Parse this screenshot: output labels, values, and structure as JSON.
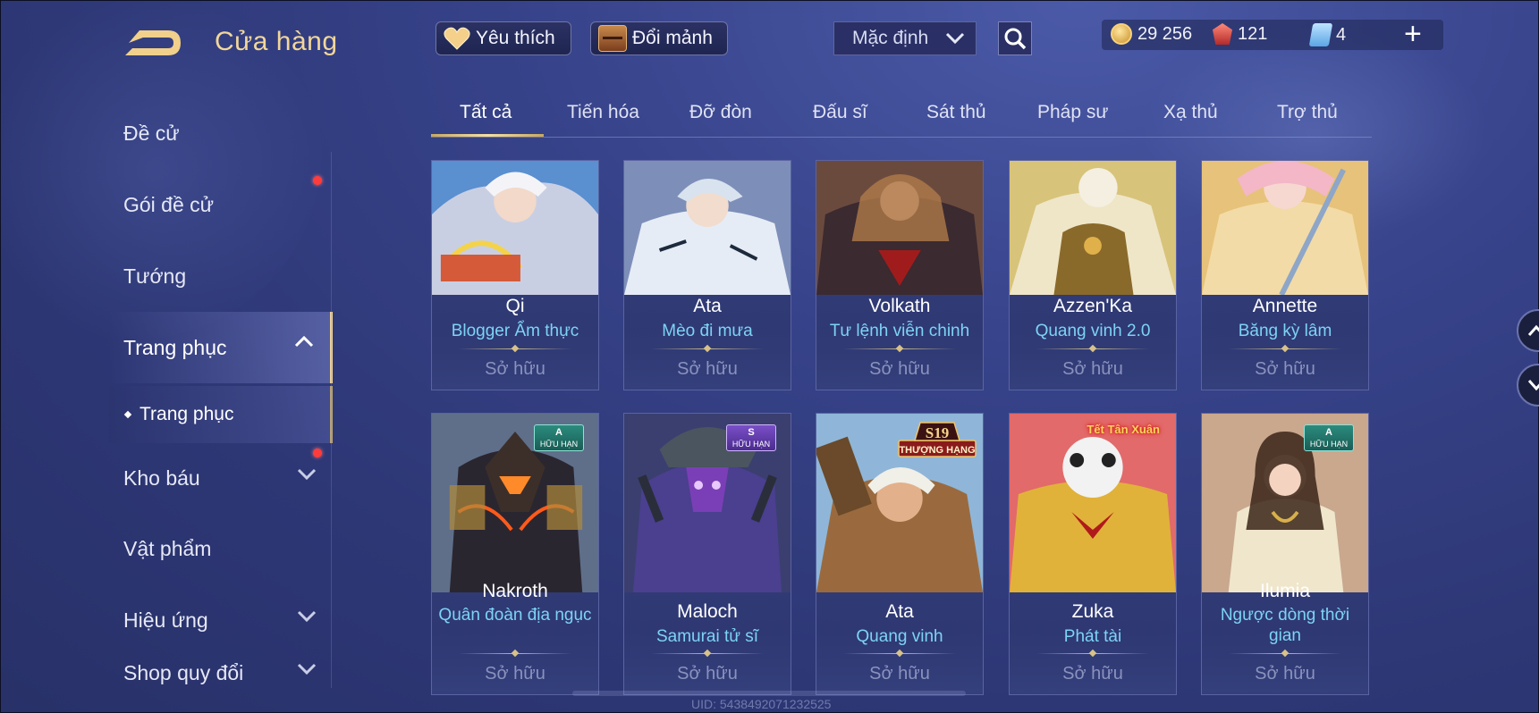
{
  "header": {
    "title": "Cửa hàng",
    "favorite_label": "Yêu thích",
    "exchange_label": "Đổi mảnh",
    "sort_value": "Mặc định"
  },
  "currency": {
    "gold": "29 256",
    "ruby": "121",
    "voucher": "4"
  },
  "sidebar": {
    "items": [
      {
        "label": "Đề cử"
      },
      {
        "label": "Gói đề cử"
      },
      {
        "label": "Tướng"
      },
      {
        "label": "Trang phục"
      },
      {
        "label": "Trang phục"
      },
      {
        "label": "Kho báu"
      },
      {
        "label": "Vật phẩm"
      },
      {
        "label": "Hiệu ứng"
      },
      {
        "label": "Shop quy đổi"
      }
    ]
  },
  "tabs": [
    "Tất cả",
    "Tiến hóa",
    "Đỡ đòn",
    "Đấu sĩ",
    "Sát thủ",
    "Pháp sư",
    "Xạ thủ",
    "Trợ thủ"
  ],
  "cards": [
    {
      "hero": "Qi",
      "skin": "Blogger Ẩm thực",
      "status": "Sở hữu"
    },
    {
      "hero": "Ata",
      "skin": "Mèo đi mưa",
      "status": "Sở hữu"
    },
    {
      "hero": "Volkath",
      "skin": "Tư lệnh viễn chinh",
      "status": "Sở hữu"
    },
    {
      "hero": "Azzen'Ka",
      "skin": "Quang vinh 2.0",
      "status": "Sở hữu"
    },
    {
      "hero": "Annette",
      "skin": "Băng kỳ lâm",
      "status": "Sở hữu"
    },
    {
      "hero": "Nakroth",
      "skin": "Quân đoàn địa ngục",
      "status": "Sở hữu",
      "badge_tier": "A",
      "badge_text": "HỮU HẠN"
    },
    {
      "hero": "Maloch",
      "skin": "Samurai tử sĩ",
      "status": "Sở hữu",
      "badge_tier": "S",
      "badge_text": "HỮU HẠN"
    },
    {
      "hero": "Ata",
      "skin": "Quang vinh",
      "status": "Sở hữu",
      "rank_season": "S19",
      "rank_text": "THƯỢNG HẠNG"
    },
    {
      "hero": "Zuka",
      "skin": "Phát tài",
      "status": "Sở hữu",
      "event_text": "Tết Tân Xuân"
    },
    {
      "hero": "Ilumia",
      "skin": "Ngược dòng thời gian",
      "status": "Sở hữu",
      "badge_tier": "A",
      "badge_text": "HỮU HẠN"
    }
  ],
  "footer": {
    "uid": "UID: 5438492071232525"
  },
  "colors": {
    "accent_gold": "#f2d79a",
    "skin_name": "#7dd3f5",
    "owned_text": "#8b92bd",
    "notification": "#ff3b3b"
  },
  "icons": [
    "back-icon",
    "heart-icon",
    "chest-icon",
    "chevron-down-icon",
    "search-icon",
    "gold-coin-icon",
    "ruby-icon",
    "voucher-icon",
    "plus-icon",
    "chevron-up-icon"
  ]
}
